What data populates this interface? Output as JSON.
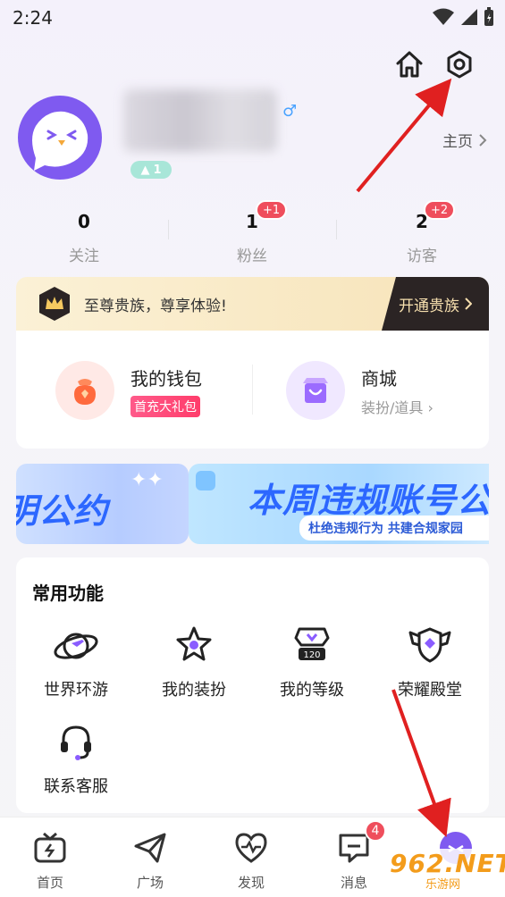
{
  "status_bar": {
    "time": "2:24"
  },
  "profile": {
    "level": "1",
    "homepage_label": "主页"
  },
  "stats": [
    {
      "value": "0",
      "label": "关注",
      "badge": ""
    },
    {
      "value": "1",
      "label": "粉丝",
      "badge": "+1"
    },
    {
      "value": "2",
      "label": "访客",
      "badge": "+2"
    }
  ],
  "vip": {
    "text": "至尊贵族，尊享体验!",
    "button": "开通贵族"
  },
  "wallet": {
    "title": "我的钱包",
    "tag": "首充大礼包"
  },
  "shop": {
    "title": "商城",
    "subtitle": "装扮/道具"
  },
  "banners": {
    "left_big": "明公约",
    "right_big": "本周违规账号公",
    "right_small": "杜绝违规行为 共建合规家园"
  },
  "features": {
    "title": "常用功能",
    "items": [
      {
        "label": "世界环游",
        "icon": "planet-plane-icon"
      },
      {
        "label": "我的装扮",
        "icon": "star-outfit-icon"
      },
      {
        "label": "我的等级",
        "icon": "level-badge-icon"
      },
      {
        "label": "荣耀殿堂",
        "icon": "shield-wings-icon"
      },
      {
        "label": "联系客服",
        "icon": "headset-icon"
      }
    ]
  },
  "nav": [
    {
      "label": "首页",
      "icon": "tv-icon"
    },
    {
      "label": "广场",
      "icon": "paper-plane-icon"
    },
    {
      "label": "发现",
      "icon": "heart-pulse-icon"
    },
    {
      "label": "消息",
      "icon": "message-icon",
      "badge": "4"
    },
    {
      "label": "",
      "icon": "avatar-icon"
    }
  ],
  "watermark": {
    "big": "962.NET",
    "small": "乐游网"
  },
  "colors": {
    "accent": "#7f5af0",
    "badge": "#ef4e5c",
    "vip_dark": "#2b2424",
    "arrow": "#e02020"
  }
}
